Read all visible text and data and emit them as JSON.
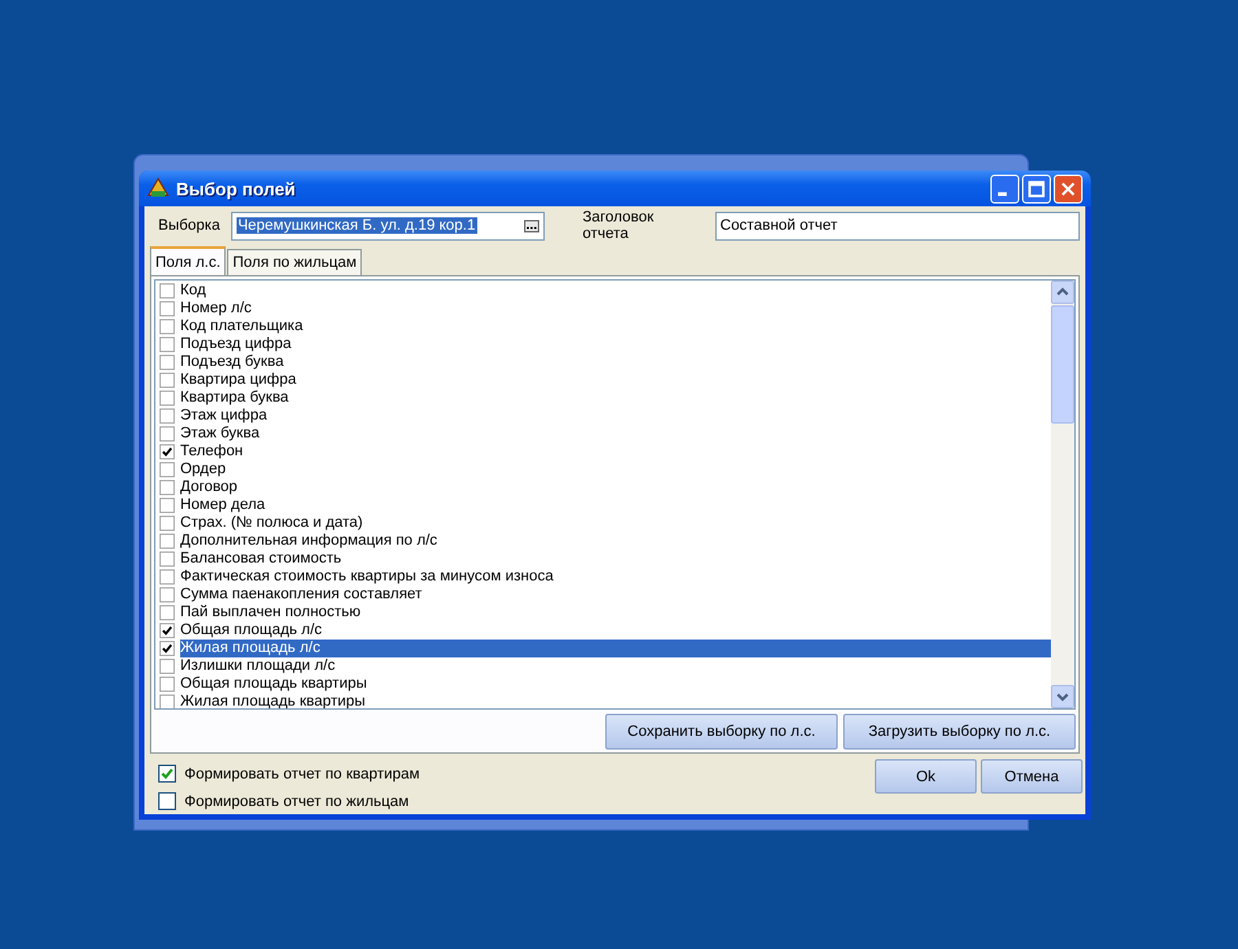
{
  "window": {
    "title": "Выбор полей"
  },
  "selection": {
    "label": "Выборка",
    "value": "Черемушкинская Б. ул. д.19 кор.1"
  },
  "report_title": {
    "label": "Заголовок отчета",
    "value": "Составной отчет"
  },
  "tabs": [
    {
      "label": "Поля л.с.",
      "selected": true
    },
    {
      "label": "Поля по жильцам",
      "selected": false
    }
  ],
  "fields": [
    {
      "label": "Код",
      "checked": false,
      "selected": false
    },
    {
      "label": "Номер л/с",
      "checked": false,
      "selected": false
    },
    {
      "label": "Код плательщика",
      "checked": false,
      "selected": false
    },
    {
      "label": "Подъезд цифра",
      "checked": false,
      "selected": false
    },
    {
      "label": "Подъезд буква",
      "checked": false,
      "selected": false
    },
    {
      "label": "Квартира цифра",
      "checked": false,
      "selected": false
    },
    {
      "label": "Квартира буква",
      "checked": false,
      "selected": false
    },
    {
      "label": "Этаж цифра",
      "checked": false,
      "selected": false
    },
    {
      "label": "Этаж буква",
      "checked": false,
      "selected": false
    },
    {
      "label": "Телефон",
      "checked": true,
      "selected": false
    },
    {
      "label": "Ордер",
      "checked": false,
      "selected": false
    },
    {
      "label": "Договор",
      "checked": false,
      "selected": false
    },
    {
      "label": "Номер дела",
      "checked": false,
      "selected": false
    },
    {
      "label": "Страх. (№ полюса и дата)",
      "checked": false,
      "selected": false
    },
    {
      "label": "Дополнительная информация по л/с",
      "checked": false,
      "selected": false
    },
    {
      "label": "Балансовая стоимость",
      "checked": false,
      "selected": false
    },
    {
      "label": "Фактическая стоимость квартиры за минусом износа",
      "checked": false,
      "selected": false
    },
    {
      "label": "Сумма паенакопления составляет",
      "checked": false,
      "selected": false
    },
    {
      "label": "Пай выплачен полностью",
      "checked": false,
      "selected": false
    },
    {
      "label": "Общая площадь л/с",
      "checked": true,
      "selected": false
    },
    {
      "label": "Жилая площадь л/с",
      "checked": true,
      "selected": true
    },
    {
      "label": "Излишки площади л/с",
      "checked": false,
      "selected": false
    },
    {
      "label": "Общая площадь квартиры",
      "checked": false,
      "selected": false
    },
    {
      "label": "Жилая площадь квартиры",
      "checked": false,
      "selected": false
    }
  ],
  "list_buttons": [
    "Сохранить выборку по л.с.",
    "Загрузить выборку по л.с."
  ],
  "options": [
    {
      "label": "Формировать отчет по квартирам",
      "checked": true
    },
    {
      "label": "Формировать отчет по жильцам",
      "checked": false
    }
  ],
  "buttons": [
    "Ok",
    "Отмена"
  ]
}
